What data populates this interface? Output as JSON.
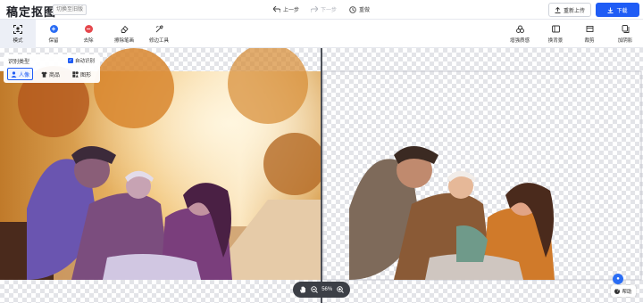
{
  "app": {
    "title": "稿定抠图",
    "version_tag": "切换至旧版"
  },
  "history": {
    "undo": "上一步",
    "redo": "下一步",
    "reset": "重做"
  },
  "actions": {
    "reupload": "重新上传",
    "download": "下载"
  },
  "toolbar": {
    "left": [
      {
        "label": "模式",
        "icon": "mode-icon"
      },
      {
        "label": "保留",
        "icon": "plus-circle-icon"
      },
      {
        "label": "去除",
        "icon": "minus-circle-icon"
      },
      {
        "label": "擦除笔画",
        "icon": "eraser-icon"
      },
      {
        "label": "修边工具",
        "icon": "edge-brush-icon"
      }
    ],
    "right": [
      {
        "label": "增强质感",
        "icon": "enhance-icon"
      },
      {
        "label": "换背景",
        "icon": "background-icon"
      },
      {
        "label": "裁剪",
        "icon": "crop-icon"
      },
      {
        "label": "加阴影",
        "icon": "shadow-icon"
      }
    ]
  },
  "detect": {
    "title": "识别类型",
    "auto_label": "自动识别",
    "auto_checked": true,
    "modes": [
      {
        "label": "人像",
        "icon": "person-icon",
        "active": true
      },
      {
        "label": "商品",
        "icon": "shirt-icon",
        "active": false
      },
      {
        "label": "图形",
        "icon": "shapes-icon",
        "active": false
      }
    ]
  },
  "zoom": {
    "value": "56%"
  },
  "help": {
    "label": "帮助"
  },
  "colors": {
    "accent": "#1f5cf5",
    "toolbar_bg": "#ffffff"
  }
}
